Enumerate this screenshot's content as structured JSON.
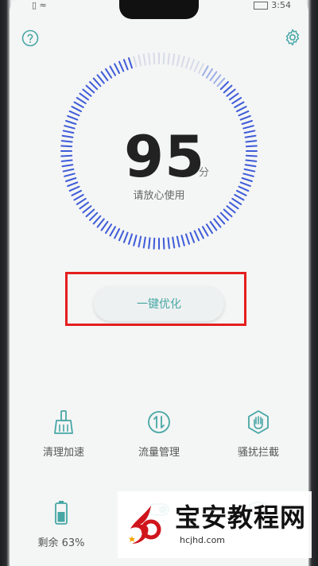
{
  "status": {
    "time": "3:54"
  },
  "header": {
    "help_icon": "question-circle-icon",
    "settings_icon": "gear-icon"
  },
  "score": {
    "value": "95",
    "unit": "分",
    "message": "请放心使用"
  },
  "actions": {
    "optimize_label": "一键优化"
  },
  "tools": [
    {
      "label": "清理加速",
      "icon": "broom-icon"
    },
    {
      "label": "流量管理",
      "icon": "data-traffic-icon"
    },
    {
      "label": "骚扰拦截",
      "icon": "hand-stop-icon"
    },
    {
      "label": "剩余 63%",
      "icon": "battery-icon"
    },
    {
      "label": "",
      "icon": "toggle-icon"
    },
    {
      "label": "",
      "icon": "shield-icon"
    }
  ],
  "watermark": {
    "title": "宝安教程网",
    "url": "hcjhd.com"
  },
  "colors": {
    "accent": "#47a7a5",
    "gauge": "#3d5bd8",
    "highlight": "#e41e1e"
  }
}
